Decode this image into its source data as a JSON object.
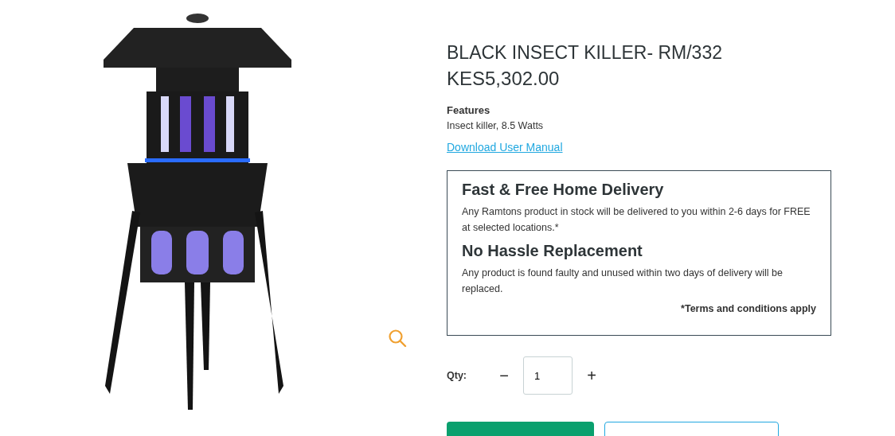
{
  "product": {
    "title": "BLACK INSECT KILLER- RM/332",
    "price": "KES5,302.00",
    "features_heading": "Features",
    "features_text": "Insect killer, 8.5 Watts",
    "manual_link": "Download User Manual"
  },
  "delivery_box": {
    "sections": [
      {
        "heading": "Fast & Free Home Delivery",
        "text": "Any Ramtons product in stock will be delivered to you within 2-6 days for FREE at selected locations.*"
      },
      {
        "heading": "No Hassle Replacement",
        "text": "Any product is found faulty and unused within two days of delivery will be replaced."
      }
    ],
    "terms": "*Terms and conditions apply"
  },
  "quantity": {
    "label": "Qty:",
    "minus": "−",
    "value": "1",
    "plus": "+"
  }
}
